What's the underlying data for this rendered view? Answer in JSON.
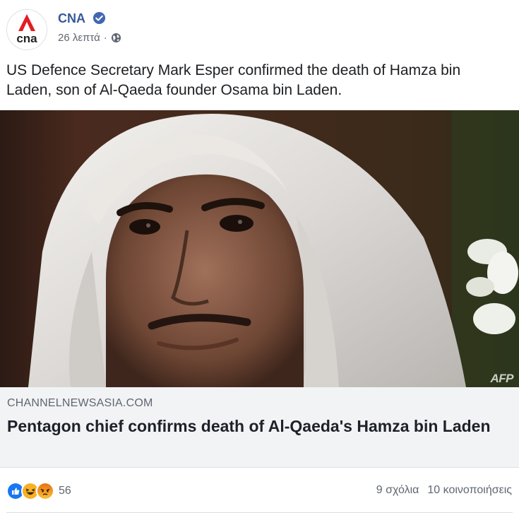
{
  "post": {
    "page_name": "CNA",
    "avatar_text": "cna",
    "timestamp": "26 λεπτά",
    "separator": "·",
    "caption": "US Defence Secretary Mark Esper confirmed the death of Hamza bin Laden, son of Al-Qaeda founder Osama bin Laden.",
    "image_watermark": "AFP"
  },
  "link_preview": {
    "domain": "CHANNELNEWSASIA.COM",
    "headline": "Pentagon chief confirms death of Al-Qaeda's Hamza bin Laden"
  },
  "engagement": {
    "reaction_count": "56",
    "comments": "9 σχόλια",
    "shares": "10 κοινοποιήσεις"
  },
  "colors": {
    "brand_red": "#e31b23",
    "link_blue": "#385898",
    "like_blue": "#1877f2"
  },
  "icons": [
    "cna-logo",
    "verified-badge-icon",
    "globe-icon",
    "like-reaction-icon",
    "haha-reaction-icon",
    "angry-reaction-icon"
  ]
}
